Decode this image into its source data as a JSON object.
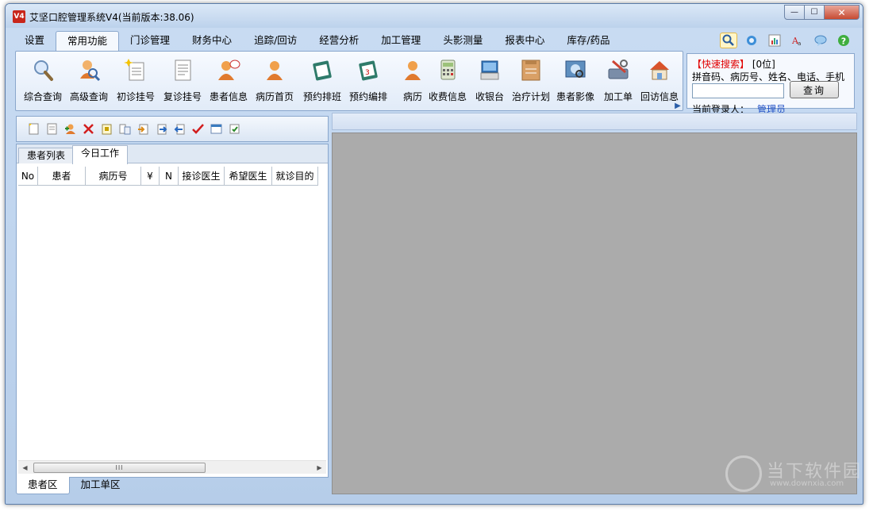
{
  "window": {
    "title": "艾坚口腔管理系统V4(当前版本:38.06)",
    "app_icon_text": "V4"
  },
  "window_controls": {
    "minimize": "—",
    "maximize": "☐",
    "close": "✕"
  },
  "menu": {
    "tabs": [
      "设置",
      "常用功能",
      "门诊管理",
      "财务中心",
      "追踪/回访",
      "经营分析",
      "加工管理",
      "头影测量",
      "报表中心",
      "库存/药品"
    ]
  },
  "ribbon": {
    "buttons": [
      {
        "label": "综合查询",
        "icon": "magnifier-icon"
      },
      {
        "label": "高级查询",
        "icon": "advanced-search-icon"
      },
      {
        "label": "初诊挂号",
        "icon": "new-registration-icon"
      },
      {
        "label": "复诊挂号",
        "icon": "revisit-registration-icon"
      },
      {
        "label": "患者信息",
        "icon": "patient-info-icon"
      },
      {
        "label": "病历首页",
        "icon": "record-home-icon"
      },
      {
        "label": "预约排班",
        "icon": "schedule-icon"
      },
      {
        "label": "预约编排",
        "icon": "appointment-arrange-icon"
      },
      {
        "label": "病历",
        "icon": "medical-record-icon"
      },
      {
        "label": "收费信息",
        "icon": "calculator-icon"
      },
      {
        "label": "收银台",
        "icon": "cashier-icon"
      },
      {
        "label": "治疗计划",
        "icon": "treatment-plan-icon"
      },
      {
        "label": "患者影像",
        "icon": "patient-image-icon"
      },
      {
        "label": "加工单",
        "icon": "tools-icon"
      },
      {
        "label": "回访信息",
        "icon": "house-icon"
      }
    ],
    "overflow_arrow": "▶"
  },
  "tools": [
    "search-icon",
    "refresh-icon",
    "chart-icon",
    "font-icon",
    "chat-icon",
    "help-icon"
  ],
  "quick_search": {
    "title": "【快速搜索】",
    "count": "[0位]",
    "hint": "拼音码、病历号、姓名、电话、手机",
    "input_value": "",
    "button": "查询",
    "login_label": "当前登录人：",
    "login_user": "管理员"
  },
  "patient_tabs": [
    "患者列表",
    "今日工作"
  ],
  "grid_columns": [
    "No",
    "患者",
    "病历号",
    "¥",
    "N",
    "接诊医生",
    "希望医生",
    "就诊目的"
  ],
  "scrollbar": {
    "left": "◀",
    "right": "▶",
    "grip": "III"
  },
  "bottom_tabs": [
    "患者区",
    "加工单区"
  ],
  "watermark": {
    "main": "当下软件园",
    "sub": "www.downxia.com"
  },
  "colors": {
    "accent_red": "#e10000",
    "link_blue": "#1f4fc5",
    "workspace_gray": "#ababab"
  }
}
